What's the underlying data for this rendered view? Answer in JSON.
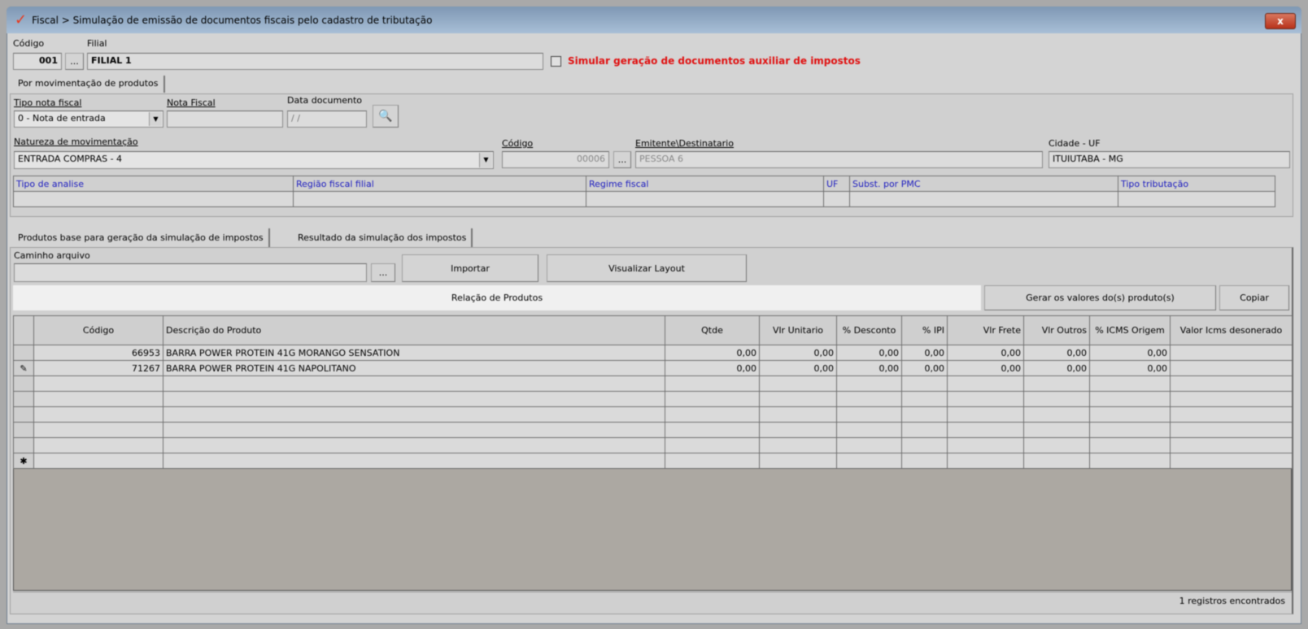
{
  "window": {
    "title": "Fiscal > Simulação de emissão de documentos fiscais pelo cadastro de tributação",
    "close": "x"
  },
  "header": {
    "codigo_label": "Código",
    "codigo_value": "001",
    "filial_label": "Filial",
    "filial_value": "FILIAL 1",
    "ellipsis": "...",
    "simular_label": "Simular geração de documentos auxiliar de impostos"
  },
  "tab_top": "Por movimentação de produtos",
  "form": {
    "tipo_nota_label": "Tipo nota fiscal",
    "tipo_nota_value": "0 - Nota de entrada",
    "nota_fiscal_label": "Nota Fiscal",
    "nota_fiscal_value": "",
    "data_doc_label": "Data documento",
    "data_doc_value": " /  /",
    "natureza_label": "Natureza de movimentação",
    "natureza_value": "ENTRADA COMPRAS - 4",
    "codigo_label": "Código",
    "codigo_value": "00006",
    "emitente_label": "Emitente\\Destinatario",
    "emitente_value": "PESSOA 6",
    "cidade_label": "Cidade - UF",
    "cidade_value": "ITUIUTABA - MG"
  },
  "analysis_grid": {
    "columns": [
      "Tipo de analise",
      "Região fiscal filial",
      "Regime fiscal",
      "UF",
      "Subst. por PMC",
      "Tipo tributação"
    ]
  },
  "tabs": [
    "Produtos base para geração da simulação de impostos",
    "Resultado da simulação dos impostos"
  ],
  "import": {
    "caminho_label": "Caminho arquivo",
    "caminho_value": "",
    "importar": "Importar",
    "visualizar": "Visualizar Layout"
  },
  "relacao": {
    "title": "Relação de Produtos",
    "gerar": "Gerar os valores do(s) produto(s)",
    "copiar": "Copiar"
  },
  "products": {
    "columns": [
      "Código",
      "Descrição do Produto",
      "Qtde",
      "Vlr Unitario",
      "% Desconto",
      "% IPI",
      "Vlr Frete",
      "Vlr Outros",
      "% ICMS Origem",
      "Valor Icms desonerado"
    ],
    "rows": [
      [
        "66953",
        "BARRA POWER PROTEIN 41G MORANGO SENSATION",
        "0,00",
        "0,00",
        "0,00",
        "0,00",
        "0,00",
        "0,00",
        "0,00",
        ""
      ],
      [
        "71267",
        "BARRA POWER PROTEIN 41G NAPOLITANO",
        "0,00",
        "0,00",
        "0,00",
        "0,00",
        "0,00",
        "0,00",
        "0,00",
        ""
      ]
    ]
  },
  "status": "1 registros encontrados"
}
